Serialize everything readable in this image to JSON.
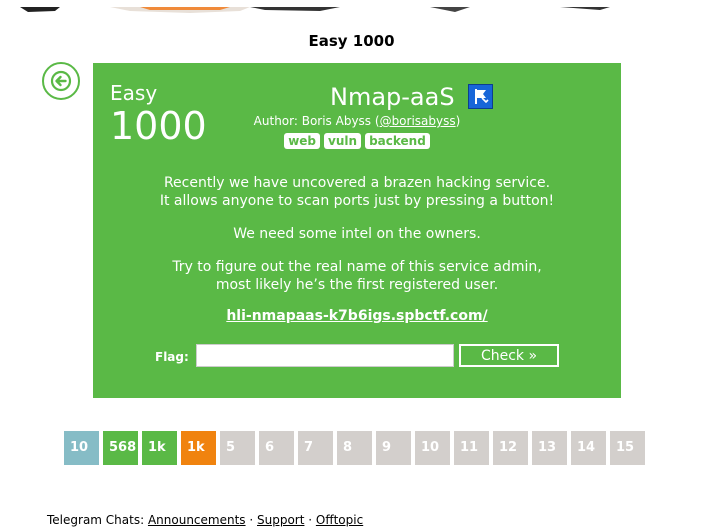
{
  "header": {
    "title": "Easy 1000"
  },
  "task": {
    "difficulty": "Easy",
    "points": "1000",
    "name": "Nmap-aaS",
    "author_prefix": "Author: Boris Abyss (",
    "author_handle": "@borisabyss",
    "author_suffix": ")",
    "tags": [
      "web",
      "vuln",
      "backend"
    ],
    "description": [
      "Recently we have uncovered a brazen hacking service.",
      "It allows anyone to scan ports just by pressing a button!",
      "We need some intel on the owners.",
      "Try to figure out the real name of this service admin,",
      "most likely he’s the first registered user."
    ],
    "link": "hli-nmapaas-k7b6igs.spbctf.com/",
    "flag_label": "Flag:",
    "flag_value": "",
    "check_label": "Check »"
  },
  "pager": [
    {
      "label": "10",
      "color": "#86bcc6"
    },
    {
      "label": "568",
      "color": "#5ab946"
    },
    {
      "label": "1k",
      "color": "#5ab946"
    },
    {
      "label": "1k",
      "color": "#f0830f"
    },
    {
      "label": "5",
      "color": "#d3cfcc"
    },
    {
      "label": "6",
      "color": "#d3cfcc"
    },
    {
      "label": "7",
      "color": "#d3cfcc"
    },
    {
      "label": "8",
      "color": "#d3cfcc"
    },
    {
      "label": "9",
      "color": "#d3cfcc"
    },
    {
      "label": "10",
      "color": "#d3cfcc"
    },
    {
      "label": "11",
      "color": "#d3cfcc"
    },
    {
      "label": "12",
      "color": "#d3cfcc"
    },
    {
      "label": "13",
      "color": "#d3cfcc"
    },
    {
      "label": "14",
      "color": "#d3cfcc"
    },
    {
      "label": "15",
      "color": "#d3cfcc"
    }
  ],
  "footer": {
    "prefix": "Telegram Chats: ",
    "links": [
      "Announcements",
      "Support",
      "Offtopic"
    ],
    "separator": " · "
  },
  "colors": {
    "accent": "#5ab946",
    "active": "#f0830f",
    "first": "#86bcc6",
    "inactive": "#d3cfcc",
    "flag_icon": "#1766d8"
  }
}
